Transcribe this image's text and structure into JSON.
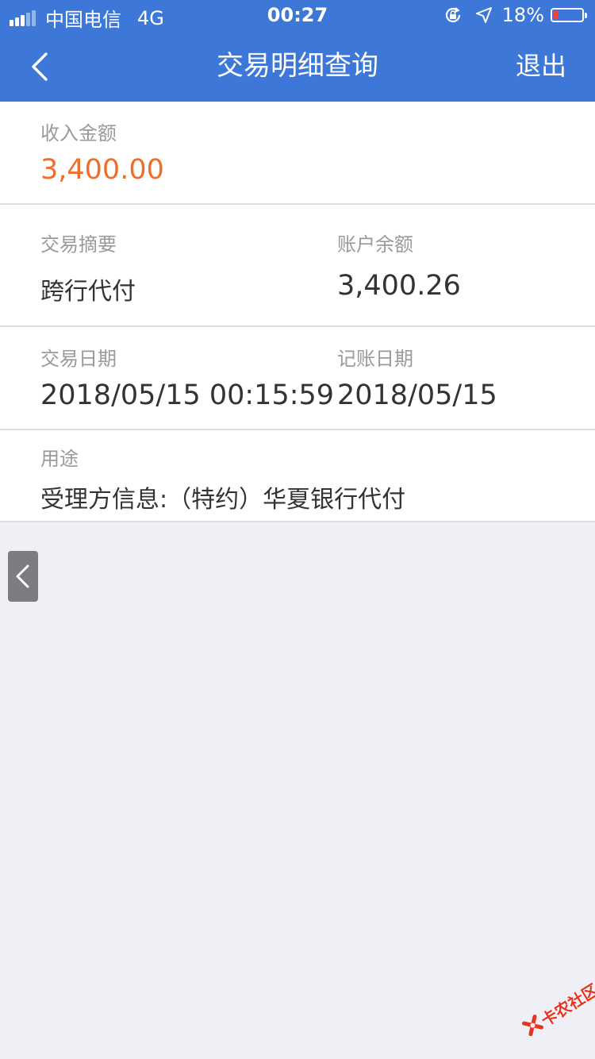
{
  "status_bar": {
    "carrier": "中国电信",
    "network": "4G",
    "time": "00:27",
    "battery_percent": "18%",
    "battery_level": 0.18,
    "battery_color": "#ff3b30"
  },
  "nav": {
    "back_icon": "chevron-left-icon",
    "title": "交易明细查询",
    "logout_label": "退出"
  },
  "detail": {
    "income_label": "收入金额",
    "income_amount": "3,400.00",
    "income_color": "#f06d2c",
    "summary_label": "交易摘要",
    "summary_value": "跨行代付",
    "balance_label": "账户余额",
    "balance_value": "3,400.26",
    "trade_date_label": "交易日期",
    "trade_date_value": "2018/05/15 00:15:59",
    "post_date_label": "记账日期",
    "post_date_value": "2018/05/15",
    "purpose_label": "用途",
    "purpose_value": "受理方信息:（特约）华夏银行代付"
  },
  "floating": {
    "back_icon": "chevron-left-icon"
  },
  "watermark": {
    "text": "卡农社区",
    "color": "#e8341f"
  },
  "colors": {
    "header_bg": "#3d78d8",
    "page_bg": "#eff0f5"
  }
}
